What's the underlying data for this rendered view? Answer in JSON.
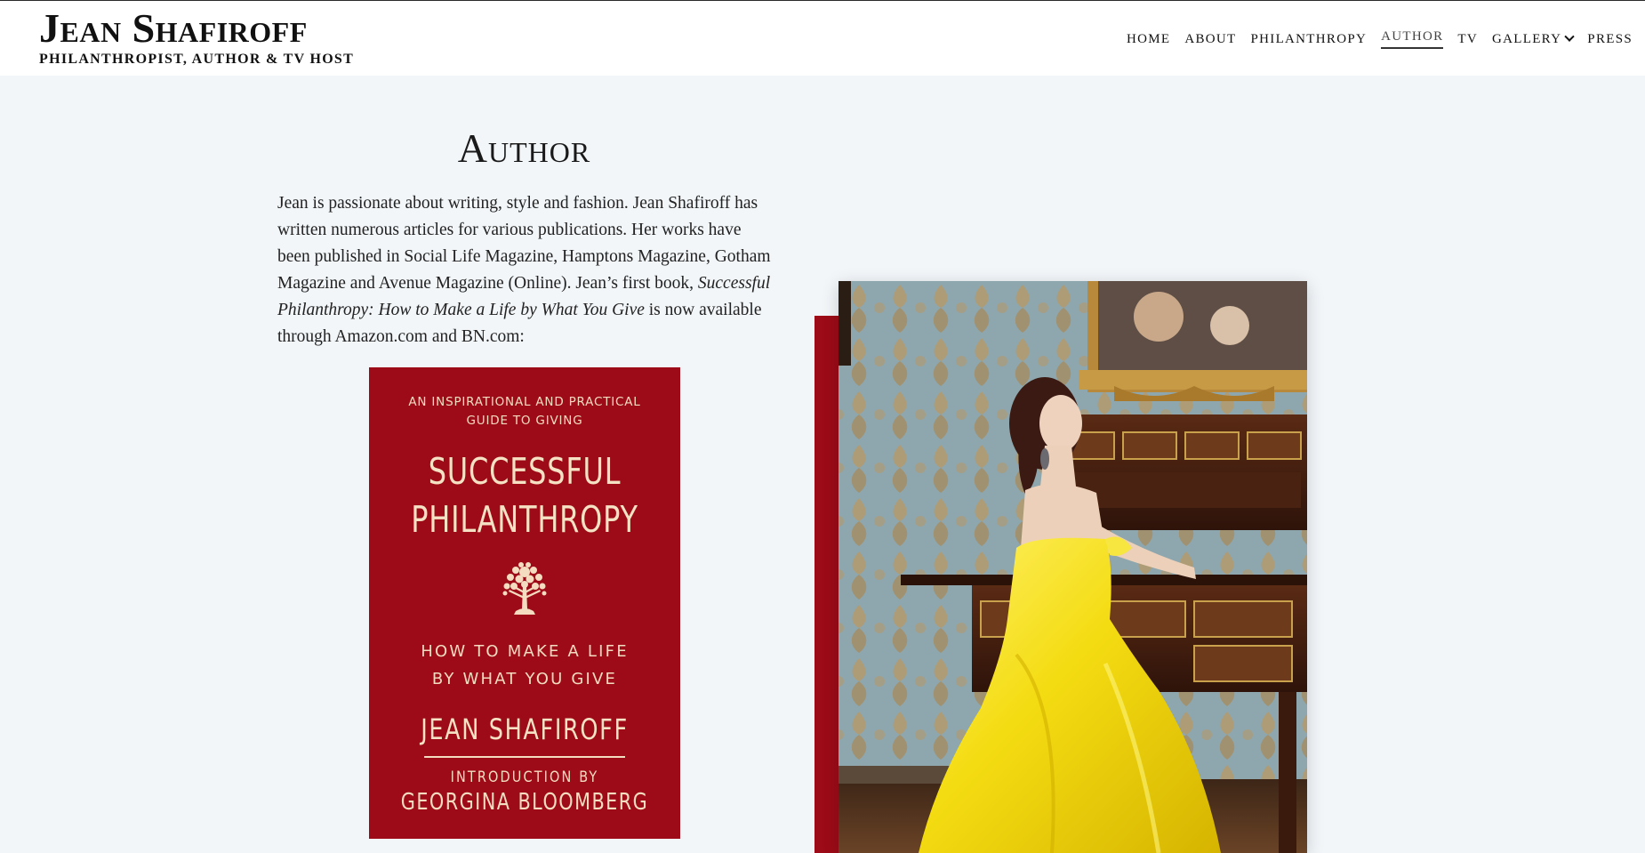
{
  "header": {
    "brand_name": "Jean Shafiroff",
    "tagline": "PHILANTHROPIST, AUTHOR & TV HOST"
  },
  "nav": {
    "items": [
      {
        "label": "HOME",
        "active": false
      },
      {
        "label": "ABOUT",
        "active": false
      },
      {
        "label": "PHILANTHROPY",
        "active": false
      },
      {
        "label": "AUTHOR",
        "active": true
      },
      {
        "label": "TV",
        "active": false
      },
      {
        "label": "GALLERY",
        "active": false,
        "has_dropdown": true
      },
      {
        "label": "PRESS",
        "active": false
      }
    ]
  },
  "main": {
    "title": "Author",
    "intro_before": "Jean is passionate about writing, style and fashion. Jean Shafiroff has written numerous articles for various publications. Her works have been published in Social Life Magazine, Hamptons Magazine, Gotham Magazine and Avenue Magazine (Online). Jean’s first book, ",
    "intro_book_title": "Successful Philanthropy: How to Make a Life by What You Give",
    "intro_after": " is now available through Amazon.com and BN.com:"
  },
  "book_cover": {
    "kicker_line1": "AN INSPIRATIONAL AND PRACTICAL",
    "kicker_line2": "GUIDE TO GIVING",
    "title_line1": "SUCCESSFUL",
    "title_line2": "PHILANTHROPY",
    "subtitle_line1": "HOW TO MAKE A LIFE",
    "subtitle_line2": "BY WHAT YOU GIVE",
    "author": "JEAN SHAFIROFF",
    "intro_label": "INTRODUCTION BY",
    "intro_name": "GEORGINA BLOOMBERG",
    "icon": "tree-icon"
  },
  "colors": {
    "page_bg": "#f2f6f9",
    "header_bg": "#ffffff",
    "accent_red": "#9c0b17",
    "cover_text": "#f3dcc0",
    "dress_yellow": "#f4dc12"
  }
}
